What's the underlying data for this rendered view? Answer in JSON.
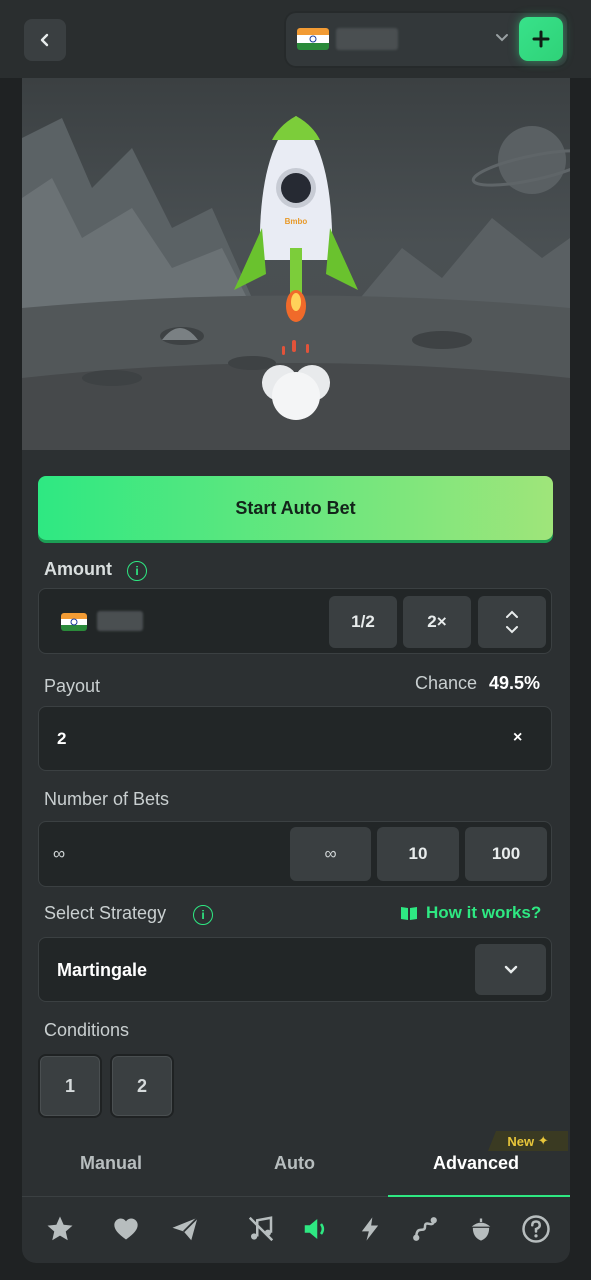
{
  "header": {
    "back_icon": "chevron-left-icon",
    "currency_flag": "india-flag",
    "plus_icon": "plus-icon"
  },
  "game": {
    "rocket_label": "Bmbo"
  },
  "controls": {
    "start_button": "Start Auto Bet",
    "amount": {
      "label": "Amount",
      "half": "1/2",
      "double": "2×"
    },
    "payout": {
      "label": "Payout",
      "chance_label": "Chance",
      "chance_value": "49.5%",
      "value": "2",
      "clear_symbol": "×"
    },
    "bets": {
      "label": "Number of Bets",
      "value": "∞",
      "options": [
        "∞",
        "10",
        "100"
      ]
    },
    "strategy": {
      "label": "Select Strategy",
      "how_it_works": "How it works?",
      "value": "Martingale"
    },
    "conditions": {
      "label": "Conditions",
      "items": [
        "1",
        "2"
      ]
    }
  },
  "tabs": {
    "items": [
      "Manual",
      "Auto",
      "Advanced"
    ],
    "active": "Advanced",
    "new_badge": "New"
  },
  "bottom_nav": {
    "icons": [
      "star-icon",
      "heart-icon",
      "send-icon",
      "music-off-icon",
      "volume-icon",
      "lightning-icon",
      "route-icon",
      "acorn-icon",
      "help-icon"
    ]
  },
  "colors": {
    "accent": "#2ee882",
    "background": "#1f2223",
    "panel": "#2c3032"
  }
}
